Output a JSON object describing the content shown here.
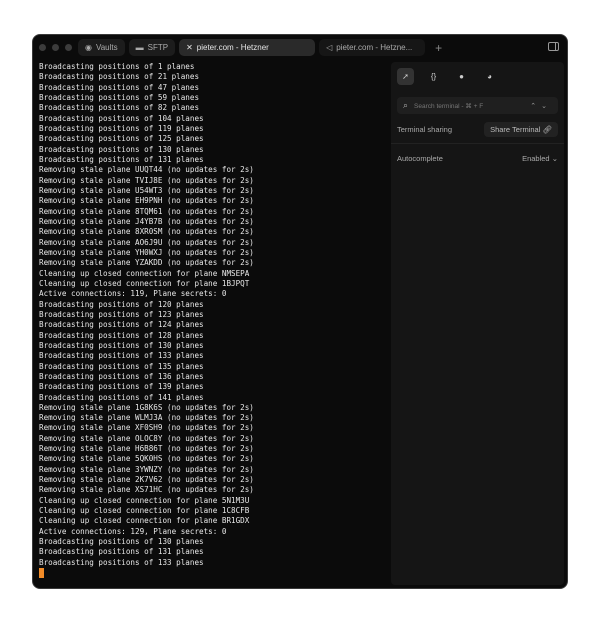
{
  "tabs": [
    {
      "label": "Vaults",
      "icon": "vault-icon"
    },
    {
      "label": "SFTP",
      "icon": "folder-icon"
    },
    {
      "label": "pieter.com - Hetzner",
      "icon": "close-icon",
      "active": true
    },
    {
      "label": "pieter.com - Hetzne...",
      "icon": "terminal-icon"
    }
  ],
  "terminal": {
    "lines": [
      "Broadcasting positions of 1 planes",
      "Broadcasting positions of 21 planes",
      "Broadcasting positions of 47 planes",
      "Broadcasting positions of 59 planes",
      "Broadcasting positions of 82 planes",
      "Broadcasting positions of 104 planes",
      "Broadcasting positions of 119 planes",
      "Broadcasting positions of 125 planes",
      "Broadcasting positions of 130 planes",
      "Broadcasting positions of 131 planes",
      "Removing stale plane UUQT44 (no updates for 2s)",
      "Removing stale plane TVIJ8E (no updates for 2s)",
      "Removing stale plane U54WT3 (no updates for 2s)",
      "Removing stale plane EH9PNH (no updates for 2s)",
      "Removing stale plane 8TQM61 (no updates for 2s)",
      "Removing stale plane J4YB7B (no updates for 2s)",
      "Removing stale plane 8XR0SM (no updates for 2s)",
      "Removing stale plane AO6J9U (no updates for 2s)",
      "Removing stale plane YH0WXJ (no updates for 2s)",
      "Removing stale plane YZAKDD (no updates for 2s)",
      "Cleaning up closed connection for plane NMSEPA",
      "Cleaning up closed connection for plane 1BJPQT",
      "Active connections: 119, Plane secrets: 0",
      "Broadcasting positions of 120 planes",
      "Broadcasting positions of 123 planes",
      "Broadcasting positions of 124 planes",
      "Broadcasting positions of 128 planes",
      "Broadcasting positions of 130 planes",
      "Broadcasting positions of 133 planes",
      "Broadcasting positions of 135 planes",
      "Broadcasting positions of 136 planes",
      "Broadcasting positions of 139 planes",
      "Broadcasting positions of 141 planes",
      "Removing stale plane 1G8K6S (no updates for 2s)",
      "Removing stale plane WLMJ3A (no updates for 2s)",
      "Removing stale plane XF0SH9 (no updates for 2s)",
      "Removing stale plane OLOC8Y (no updates for 2s)",
      "Removing stale plane H6B86T (no updates for 2s)",
      "Removing stale plane 5QK0HS (no updates for 2s)",
      "Removing stale plane 3YWNZY (no updates for 2s)",
      "Removing stale plane 2K7V62 (no updates for 2s)",
      "Removing stale plane XS71HC (no updates for 2s)",
      "Cleaning up closed connection for plane 5N1M3U",
      "Cleaning up closed connection for plane 1C8CFB",
      "Cleaning up closed connection for plane BR1GDX",
      "Active connections: 129, Plane secrets: 0",
      "Broadcasting positions of 130 planes",
      "Broadcasting positions of 131 planes",
      "Broadcasting positions of 133 planes"
    ]
  },
  "panel": {
    "search_placeholder": "Search terminal - ⌘ + F",
    "sharing_label": "Terminal sharing",
    "share_button": "Share Terminal",
    "autocomplete_label": "Autocomplete",
    "autocomplete_value": "Enabled"
  }
}
